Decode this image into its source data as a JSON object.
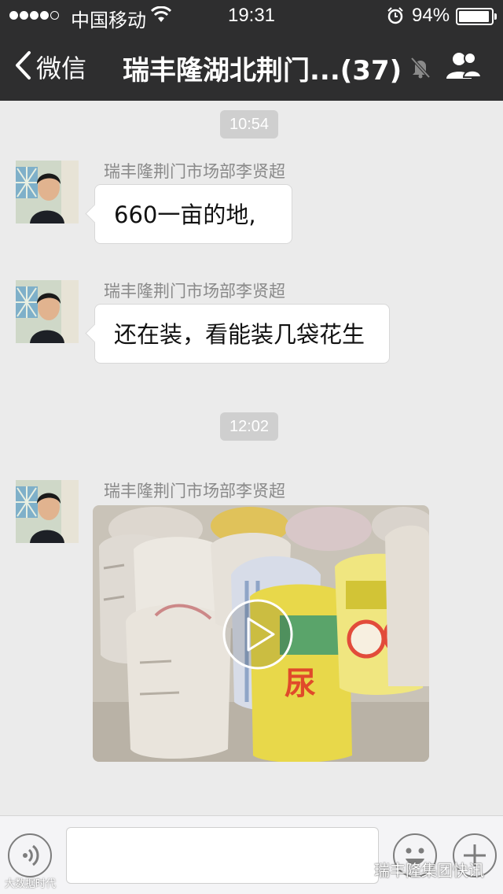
{
  "status_bar": {
    "carrier": "中国移动",
    "time": "19:31",
    "battery_percent": "94%",
    "battery_level": 0.94,
    "signal_bars": 4,
    "icons": [
      "signal-dots-icon",
      "wifi-icon",
      "alarm-icon",
      "battery-icon"
    ]
  },
  "nav": {
    "back_label": "微信",
    "title": "瑞丰隆湖北荆门...(37)",
    "icons": [
      "chevron-left-icon",
      "mute-bell-icon",
      "group-members-icon"
    ]
  },
  "chat": {
    "timestamps": [
      "10:54",
      "12:02"
    ],
    "messages": [
      {
        "sender": "瑞丰隆荆门市场部李贤超",
        "type": "text",
        "text": "660一亩的地,"
      },
      {
        "sender": "瑞丰隆荆门市场部李贤超",
        "type": "text",
        "text": "还在装，看能装几袋花生"
      },
      {
        "sender": "瑞丰隆荆门市场部李贤超",
        "type": "video",
        "video_icon": "play-icon",
        "bag_label": "尿"
      }
    ]
  },
  "input_bar": {
    "placeholder": "",
    "icons": [
      "voice-icon",
      "emoji-icon",
      "plus-icon"
    ]
  },
  "watermark": {
    "right": "瑞丰隆集团快讯",
    "left": "大数据时代"
  },
  "colors": {
    "bar_bg": "#2e2e2f",
    "chat_bg": "#ebebeb",
    "timestamp_bg": "#cfcfcf"
  }
}
